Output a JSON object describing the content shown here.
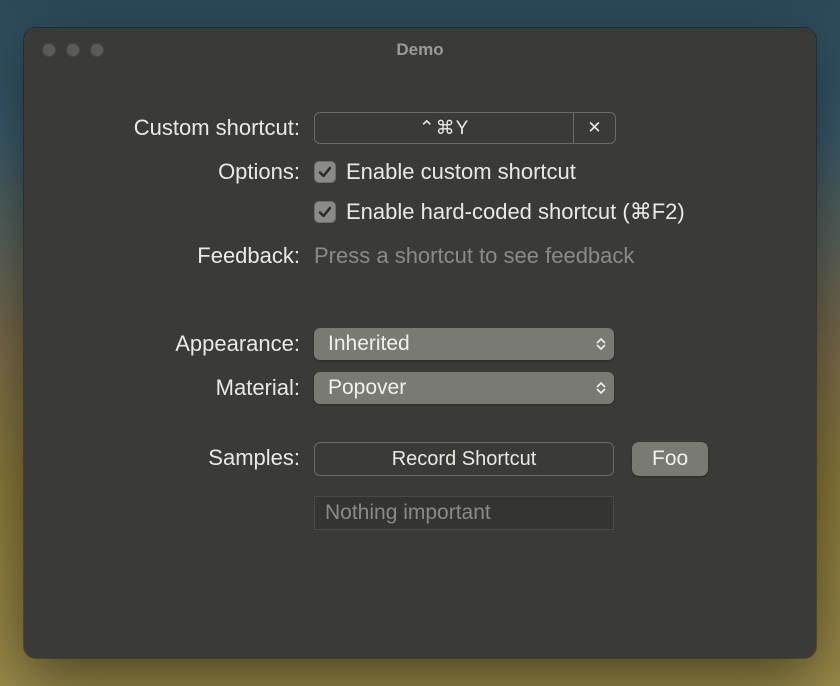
{
  "window": {
    "title": "Demo"
  },
  "custom_shortcut": {
    "label": "Custom shortcut:",
    "value": "⌃⌘Y",
    "clear_symbol": "✕"
  },
  "options": {
    "label": "Options:",
    "enable_custom": {
      "label": "Enable custom shortcut",
      "checked": true
    },
    "enable_hardcoded": {
      "label": "Enable hard-coded shortcut (⌘F2)",
      "checked": true
    }
  },
  "feedback": {
    "label": "Feedback:",
    "placeholder": "Press a shortcut to see feedback"
  },
  "appearance": {
    "label": "Appearance:",
    "value": "Inherited"
  },
  "material": {
    "label": "Material:",
    "value": "Popover"
  },
  "samples": {
    "label": "Samples:",
    "record_label": "Record Shortcut",
    "foo_label": "Foo",
    "input_placeholder": "Nothing important"
  }
}
